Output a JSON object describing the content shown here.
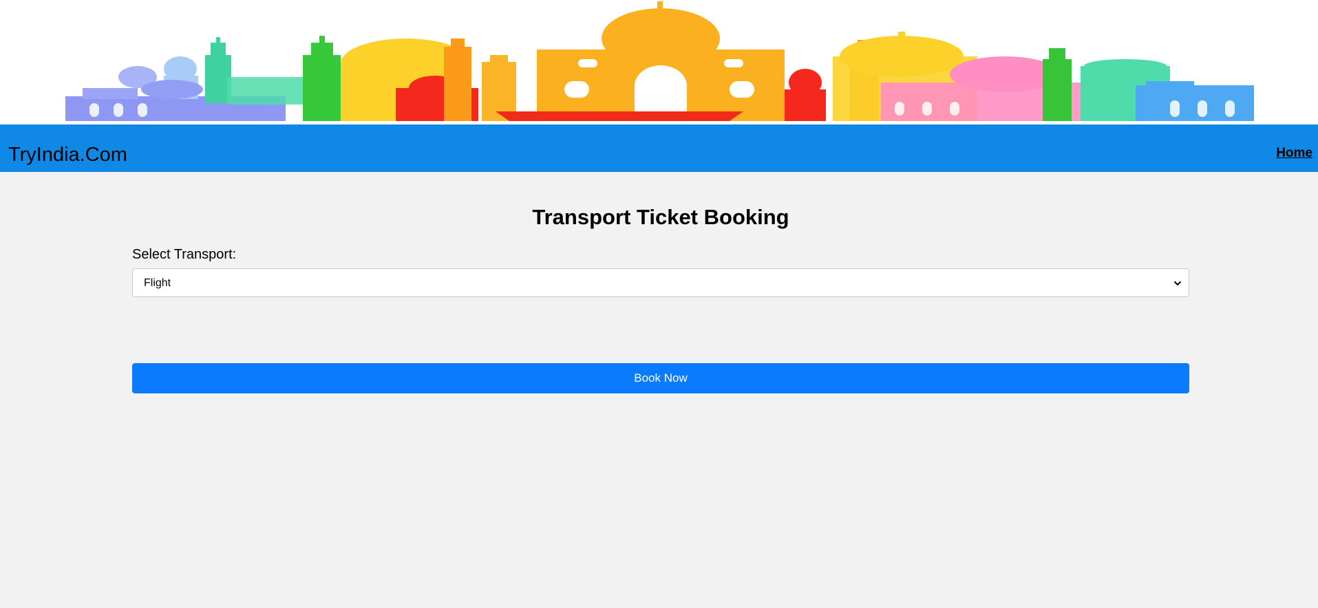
{
  "banner": {
    "icon": "india-skyline-illustration"
  },
  "nav": {
    "brand": "TryIndia.Com",
    "home_label": "Home",
    "bar_color": "#1088e6"
  },
  "main": {
    "title": "Transport Ticket Booking",
    "select_label": "Select Transport:",
    "select_value": "Flight",
    "button_label": "Book Now",
    "button_color": "#0a7aff"
  }
}
